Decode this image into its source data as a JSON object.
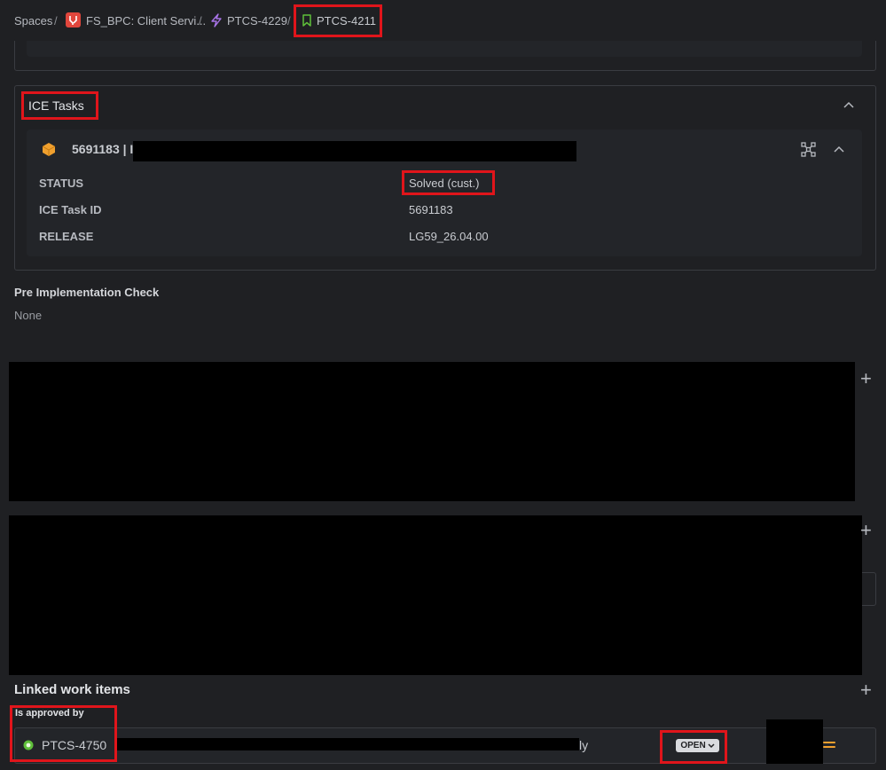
{
  "breadcrumb": {
    "spaces": "Spaces",
    "separator": "/",
    "project": "FS_BPC: Client Servi...",
    "epic": "PTCS-4229",
    "issue": "PTCS-4211"
  },
  "ice_tasks": {
    "title": "ICE Tasks",
    "task": {
      "header": "5691183 | I",
      "fields": [
        {
          "label": "STATUS",
          "value": "Solved (cust.)"
        },
        {
          "label": "ICE Task ID",
          "value": "5691183"
        },
        {
          "label": "RELEASE",
          "value": "LG59_26.04.00"
        }
      ]
    }
  },
  "pre_impl": {
    "label": "Pre Implementation Check",
    "value": "None"
  },
  "linked": {
    "title": "Linked work items",
    "group_label": "Is approved by",
    "item": {
      "key": "PTCS-4750",
      "summary_tail": "ly",
      "status": "OPEN"
    }
  },
  "colors": {
    "background": "#1f2023",
    "highlight": "#e0151b",
    "task_icon": "#f0a02e",
    "story_icon": "#5fbf3a",
    "epic_icon": "#a773e6",
    "project_icon": "#e0463c"
  }
}
